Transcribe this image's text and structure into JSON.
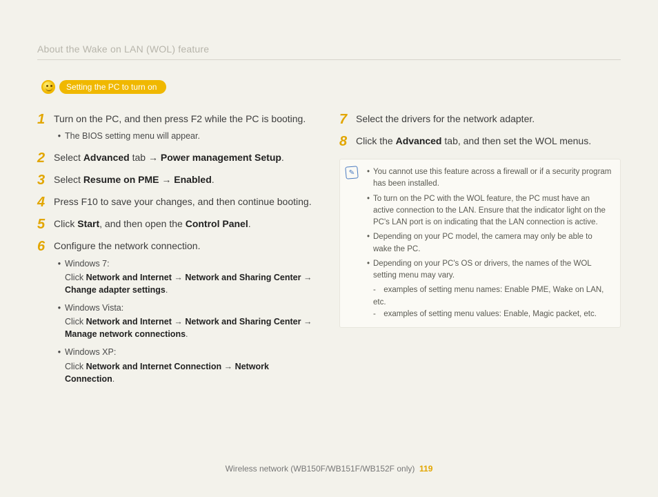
{
  "header": {
    "title": "About the Wake on LAN (WOL) feature"
  },
  "badge": {
    "label": "Setting the PC to turn on"
  },
  "arrow_glyph": "→",
  "left": {
    "steps": [
      {
        "num": "1",
        "text": "Turn on the PC, and then press F2 while the PC is booting.",
        "sub": [
          {
            "type": "dot",
            "text": "The BIOS setting menu will appear."
          }
        ]
      },
      {
        "num": "2",
        "segments": [
          "Select ",
          {
            "b": "Advanced"
          },
          " tab ",
          {
            "a": true
          },
          " ",
          {
            "b": "Power management Setup"
          },
          "."
        ]
      },
      {
        "num": "3",
        "segments": [
          "Select ",
          {
            "b": "Resume on PME"
          },
          " ",
          {
            "a": true
          },
          " ",
          {
            "b": "Enabled"
          },
          "."
        ]
      },
      {
        "num": "4",
        "text": "Press F10 to save your changes, and then continue booting."
      },
      {
        "num": "5",
        "segments": [
          "Click ",
          {
            "b": "Start"
          },
          ", and then open the ",
          {
            "b": "Control Panel"
          },
          "."
        ]
      },
      {
        "num": "6",
        "text": "Configure the network connection.",
        "sub": [
          {
            "type": "dot",
            "text": "Windows 7:"
          },
          {
            "type": "indent",
            "segments": [
              "Click ",
              {
                "b": "Network and Internet"
              },
              " ",
              {
                "a": true
              },
              " ",
              {
                "b": "Network and Sharing Center"
              },
              " ",
              {
                "a": true
              },
              " ",
              {
                "b": "Change adapter settings"
              },
              "."
            ]
          },
          {
            "type": "dot",
            "text": "Windows Vista:"
          },
          {
            "type": "indent",
            "segments": [
              "Click ",
              {
                "b": "Network and Internet"
              },
              " ",
              {
                "a": true
              },
              " ",
              {
                "b": "Network and Sharing Center"
              },
              " ",
              {
                "a": true
              },
              " ",
              {
                "b": "Manage network connections"
              },
              "."
            ]
          },
          {
            "type": "dot",
            "text": "Windows XP:"
          },
          {
            "type": "indent",
            "segments": [
              "Click ",
              {
                "b": "Network and Internet Connection"
              },
              " ",
              {
                "a": true
              },
              " ",
              {
                "b": "Network Connection"
              },
              "."
            ]
          }
        ]
      }
    ]
  },
  "right": {
    "steps": [
      {
        "num": "7",
        "text": "Select the drivers for the network adapter."
      },
      {
        "num": "8",
        "segments": [
          "Click the ",
          {
            "b": "Advanced"
          },
          " tab, and then set the WOL menus."
        ]
      }
    ],
    "notes": [
      "You cannot use this feature across a firewall or if a security program has been installed.",
      "To turn on the PC with the WOL feature, the PC must have an active connection to the LAN. Ensure that the indicator light on the PC's LAN port is on indicating that the LAN connection is active.",
      "Depending on your PC model, the camera may only be able to wake the PC.",
      "Depending on your PC's OS or drivers, the names of the WOL setting menu may vary."
    ],
    "note_sub": [
      "examples of setting menu names: Enable PME, Wake on LAN, etc.",
      "examples of setting menu values: Enable, Magic packet, etc."
    ]
  },
  "footer": {
    "text": "Wireless network (WB150F/WB151F/WB152F only)",
    "page": "119"
  }
}
